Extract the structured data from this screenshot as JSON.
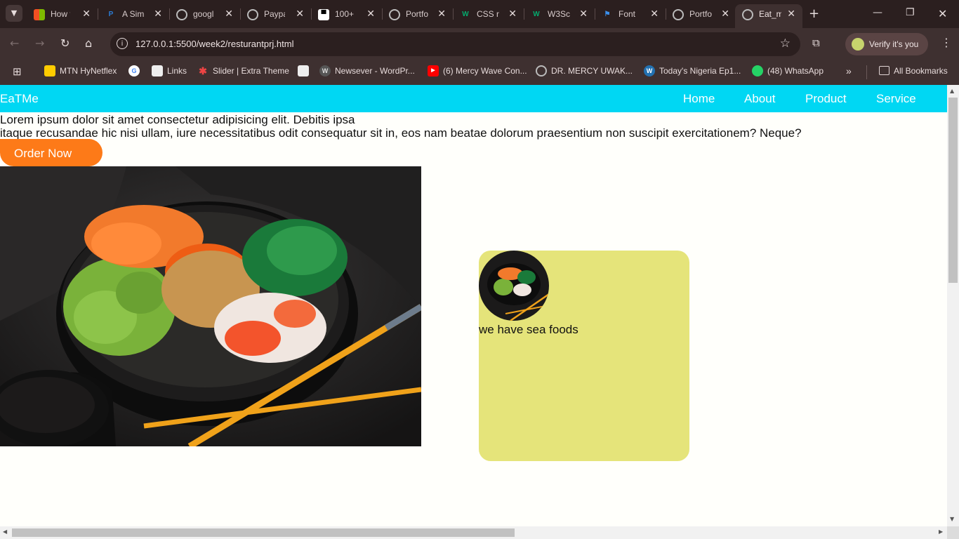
{
  "browser": {
    "tabs": [
      {
        "title": "How t",
        "icon": "microsoft-icon"
      },
      {
        "title": "A Sim",
        "icon": "paypal-icon"
      },
      {
        "title": "googl",
        "icon": "globe-icon"
      },
      {
        "title": "Paypa",
        "icon": "globe-icon"
      },
      {
        "title": "100+",
        "icon": "unsplash-icon"
      },
      {
        "title": "Portfo",
        "icon": "globe-icon"
      },
      {
        "title": "CSS n",
        "icon": "w3schools-icon"
      },
      {
        "title": "W3Sc",
        "icon": "w3schools-icon"
      },
      {
        "title": "Font",
        "icon": "flag-icon"
      },
      {
        "title": "Portfo",
        "icon": "globe-icon"
      },
      {
        "title": "Eat_m",
        "icon": "globe-icon",
        "active": true
      }
    ],
    "url": "127.0.0.1:5500/week2/resturantprj.html",
    "profile_label": "Verify it's you",
    "bookmarks": [
      {
        "label": "MTN HyNetflex",
        "icon": "mtn-icon"
      },
      {
        "label": "",
        "icon": "google-icon"
      },
      {
        "label": "Links",
        "icon": "doc-icon"
      },
      {
        "label": "Slider | Extra Theme",
        "icon": "star-icon"
      },
      {
        "label": "",
        "icon": "doc-icon"
      },
      {
        "label": "Newsever - WordPr...",
        "icon": "wordpress-icon"
      },
      {
        "label": "(6) Mercy Wave Con...",
        "icon": "youtube-icon"
      },
      {
        "label": "DR. MERCY UWAK...",
        "icon": "globe-icon"
      },
      {
        "label": "Today's Nigeria Ep1...",
        "icon": "wordpress-icon"
      },
      {
        "label": "(48) WhatsApp",
        "icon": "whatsapp-icon"
      }
    ],
    "all_bookmarks_label": "All Bookmarks"
  },
  "page": {
    "brand": "EaTMe",
    "nav": [
      "Home",
      "About",
      "Product",
      "Service"
    ],
    "lead_line1": "Lorem ipsum dolor sit amet consectetur adipisicing elit. Debitis ipsa",
    "lead_line2": "itaque recusandae hic nisi ullam, iure necessitatibus odit consequatur sit in, eos nam beatae dolorum praesentium non suscipit exercitationem? Neque?",
    "order_button": "Order Now",
    "card_text": "we have sea foods"
  },
  "colors": {
    "navbar": "#00d7f3",
    "order_button": "#fd7a18",
    "card": "#e5e47a",
    "chrome_dark": "#2b1f1f",
    "chrome_toolbar": "#3e3030"
  }
}
